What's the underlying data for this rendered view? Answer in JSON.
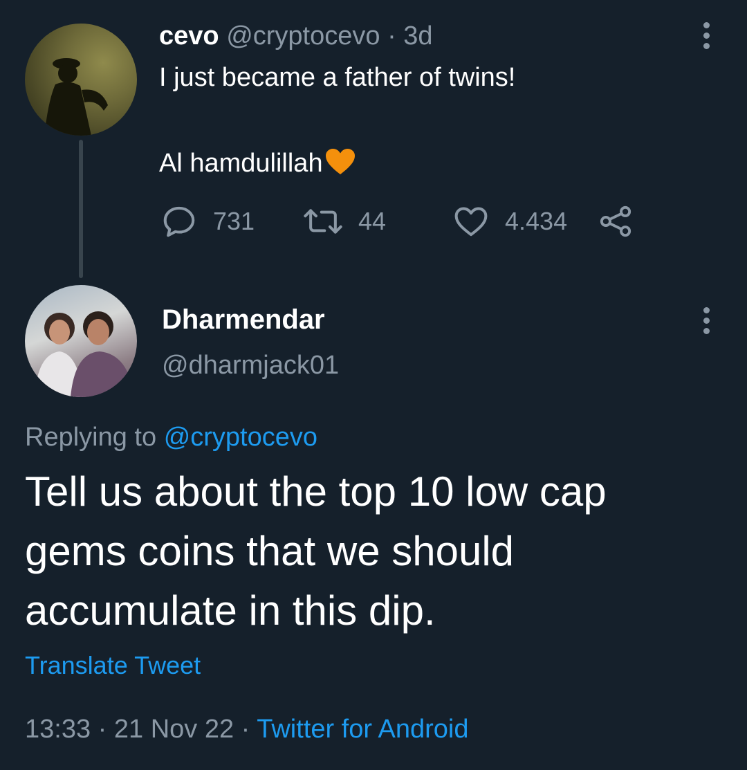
{
  "parent_tweet": {
    "name": "cevo",
    "handle": "@cryptocevo",
    "separator": "·",
    "time": "3d",
    "line1": "I just became a father of twins!",
    "line2": "Al hamdulillah",
    "emoji": "orange-heart-icon",
    "counts": {
      "replies": "731",
      "retweets": "44",
      "likes": "4.434"
    }
  },
  "reply_tweet": {
    "name": "Dharmendar",
    "handle": "@dharmjack01",
    "replying_prefix": "Replying to",
    "replying_to": "@cryptocevo",
    "text": "Tell us about the top 10 low cap gems coins that we should accumulate in this dip.",
    "translate": "Translate Tweet",
    "time": "13:33",
    "separator": "·",
    "date": "21 Nov 22",
    "source": "Twitter for Android"
  },
  "colors": {
    "background": "#15202b",
    "muted": "#8b98a5",
    "link": "#1d9bf0",
    "heart": "#f4900c"
  }
}
